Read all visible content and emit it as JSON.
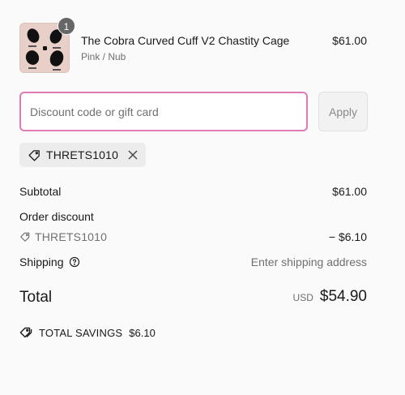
{
  "product": {
    "title": "The Cobra Curved Cuff V2 Chastity Cage",
    "variant": "Pink / Nub",
    "price": "$61.00",
    "quantity": "1",
    "image_icon": "product-thumbnail"
  },
  "discount": {
    "placeholder": "Discount code or gift card",
    "value": "",
    "apply_label": "Apply",
    "applied_code": "THRETS1010"
  },
  "summary": {
    "subtotal_label": "Subtotal",
    "subtotal_value": "$61.00",
    "order_discount_label": "Order discount",
    "discount_code": "THRETS1010",
    "discount_value": "− $6.10",
    "shipping_label": "Shipping",
    "shipping_value": "Enter shipping address",
    "total_label": "Total",
    "total_currency": "USD",
    "total_value": "$54.90",
    "savings_label": "TOTAL SAVINGS",
    "savings_value": "$6.10"
  },
  "colors": {
    "input_focus_border": "#e07bb5",
    "thumbnail_bg": "#e8cfc7",
    "badge_bg": "#666666"
  }
}
